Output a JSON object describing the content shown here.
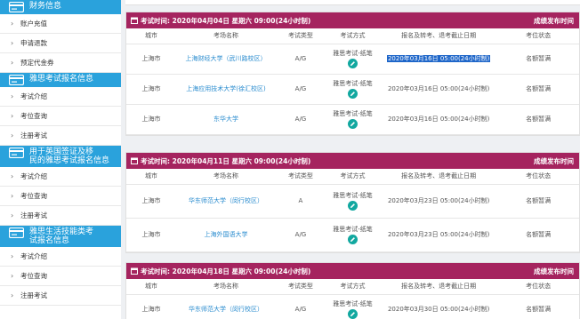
{
  "sidebar": {
    "sections": [
      {
        "title": "财务信息",
        "items": [
          "账户充值",
          "申请退款",
          "预定代金券"
        ]
      },
      {
        "title": "雅思考试报名信息",
        "items": [
          "考试介绍",
          "考位查询",
          "注册考试"
        ]
      },
      {
        "title": "用于英国签证及移\n民的雅思考试报名信息",
        "items": [
          "考试介绍",
          "考位查询",
          "注册考试"
        ]
      },
      {
        "title": "雅思生活技能类考\n试报名信息",
        "items": [
          "考试介绍",
          "考位查询",
          "注册考试"
        ]
      }
    ]
  },
  "columns": [
    "城市",
    "考场名称",
    "考试类型",
    "考试方式",
    "报名及转考、退考截止日期",
    "考位状态"
  ],
  "cards": [
    {
      "header_date": "考试时间: 2020年04月04日 星期六 09:00(24小时制)",
      "header_right": "成绩发布时间",
      "rows": [
        {
          "city": "上海市",
          "venue": "上海财经大学（武川路校区）",
          "type": "A/G",
          "method": "雅思考试-纸笔",
          "deadline": "2020年03月16日 05:00(24小时制)",
          "status": "名额暂满",
          "highlight": true
        },
        {
          "city": "上海市",
          "venue": "上海应用技术大学(徐汇校区)",
          "type": "A/G",
          "method": "雅思考试-纸笔",
          "deadline": "2020年03月16日 05:00(24小时制)",
          "status": "名额暂满",
          "highlight": false
        },
        {
          "city": "上海市",
          "venue": "东华大学",
          "type": "A/G",
          "method": "雅思考试-纸笔",
          "deadline": "2020年03月16日 05:00(24小时制)",
          "status": "名额暂满",
          "highlight": false
        }
      ]
    },
    {
      "header_date": "考试时间: 2020年04月11日 星期六 09:00(24小时制)",
      "header_right": "成绩发布时间",
      "rows": [
        {
          "city": "上海市",
          "venue": "华东师范大学（闵行校区）",
          "type": "A",
          "method": "雅思考试-纸笔",
          "deadline": "2020年03月23日 05:00(24小时制)",
          "status": "名额暂满",
          "highlight": false
        },
        {
          "city": "上海市",
          "venue": "上海外国语大学",
          "type": "A/G",
          "method": "雅思考试-纸笔",
          "deadline": "2020年03月23日 05:00(24小时制)",
          "status": "名额暂满",
          "highlight": false
        }
      ]
    },
    {
      "header_date": "考试时间: 2020年04月18日 星期六 09:00(24小时制)",
      "header_right": "成绩发布时间",
      "rows": [
        {
          "city": "上海市",
          "venue": "华东师范大学（闵行校区）",
          "type": "A/G",
          "method": "雅思考试-纸笔",
          "deadline": "2020年03月30日 05:00(24小时制)",
          "status": "名额暂满",
          "highlight": false
        }
      ]
    }
  ],
  "colors": {
    "sidebar_header": "#2aa2dc",
    "card_header": "#a5245f",
    "venue_link": "#2a8ccf",
    "pen_icon": "#12a8a0",
    "selection": "#1e66c9"
  },
  "icons": {
    "section": "card-icon",
    "header": "calendar-icon",
    "method": "pencil-icon",
    "nav": "chevron-right-icon"
  }
}
